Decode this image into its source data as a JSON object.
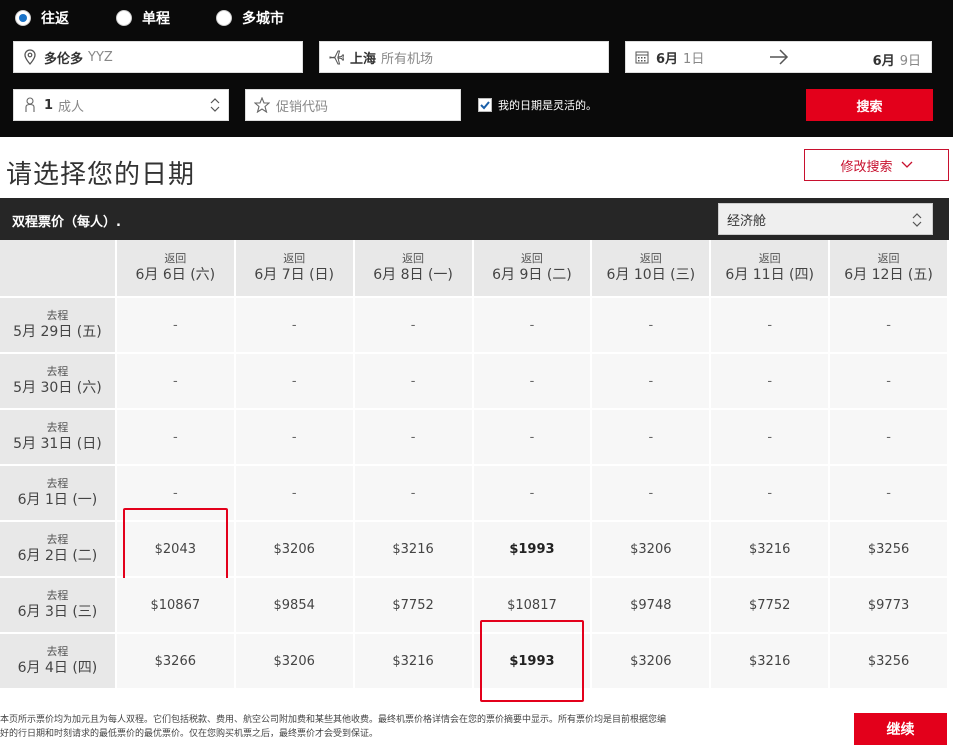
{
  "search": {
    "trip_types": [
      {
        "label": "往返",
        "selected": true
      },
      {
        "label": "单程",
        "selected": false
      },
      {
        "label": "多城市",
        "selected": false
      }
    ],
    "origin": {
      "city": "多伦多",
      "code": "YYZ"
    },
    "destination": {
      "city": "上海",
      "airports": "所有机场"
    },
    "depart_date": {
      "month": "6月",
      "day": "1日"
    },
    "return_date": {
      "month": "6月",
      "day": "9日"
    },
    "passengers": {
      "count": "1",
      "type": "成人"
    },
    "promo_placeholder": "促销代码",
    "flexible_label": "我的日期是灵活的。",
    "flexible_checked": true,
    "search_button": "搜索"
  },
  "page": {
    "title": "请选择您的日期",
    "modify_button": "修改搜索"
  },
  "grid": {
    "title": "双程票价（每人）.",
    "cabin": "经济舱",
    "col_prefix": "返回",
    "row_prefix": "去程",
    "columns": [
      "6月 6日 (六)",
      "6月 7日 (日)",
      "6月 8日 (一)",
      "6月 9日 (二)",
      "6月 10日 (三)",
      "6月 11日 (四)",
      "6月 12日 (五)"
    ],
    "rows": [
      {
        "date": "5月 29日 (五)",
        "prices": [
          "-",
          "-",
          "-",
          "-",
          "-",
          "-",
          "-"
        ]
      },
      {
        "date": "5月 30日 (六)",
        "prices": [
          "-",
          "-",
          "-",
          "-",
          "-",
          "-",
          "-"
        ]
      },
      {
        "date": "5月 31日 (日)",
        "prices": [
          "-",
          "-",
          "-",
          "-",
          "-",
          "-",
          "-"
        ]
      },
      {
        "date": "6月 1日 (一)",
        "prices": [
          "-",
          "-",
          "-",
          "-",
          "-",
          "-",
          "-"
        ]
      },
      {
        "date": "6月 2日 (二)",
        "prices": [
          "$2043",
          "$3206",
          "$3216",
          "$1993",
          "$3206",
          "$3216",
          "$3256"
        ]
      },
      {
        "date": "6月 3日 (三)",
        "prices": [
          "$10867",
          "$9854",
          "$7752",
          "$10817",
          "$9748",
          "$7752",
          "$9773"
        ]
      },
      {
        "date": "6月 4日 (四)",
        "prices": [
          "$3266",
          "$3206",
          "$3216",
          "$1993",
          "$3206",
          "$3216",
          "$3256"
        ]
      }
    ],
    "bold_cells": [
      [
        4,
        3
      ],
      [
        6,
        3
      ]
    ],
    "highlighted_cells": [
      [
        4,
        0
      ],
      [
        6,
        3
      ]
    ]
  },
  "footer": {
    "disclaimer_line1": "本页所示票价均为加元且为每人双程。它们包括税款、费用、航空公司附加费和某些其他收费。最终机票价格详情会在您的票价摘要中显示。所有票价均是目前根据您编",
    "disclaimer_line2": "好的行日期和时刻请求的最低票价的最优票价。仅在您购买机票之后，最终票价才会受到保证。",
    "continue_button": "继续"
  },
  "colors": {
    "accent_red": "#e3001b",
    "bar_black": "#0a0a0a",
    "grid_header": "#262626"
  },
  "icons": [
    "radio-icon",
    "location-pin-icon",
    "plane-icon",
    "calendar-icon",
    "arrow-right-icon",
    "person-icon",
    "sort-icon",
    "star-icon",
    "check-icon",
    "chevron-down-icon"
  ]
}
